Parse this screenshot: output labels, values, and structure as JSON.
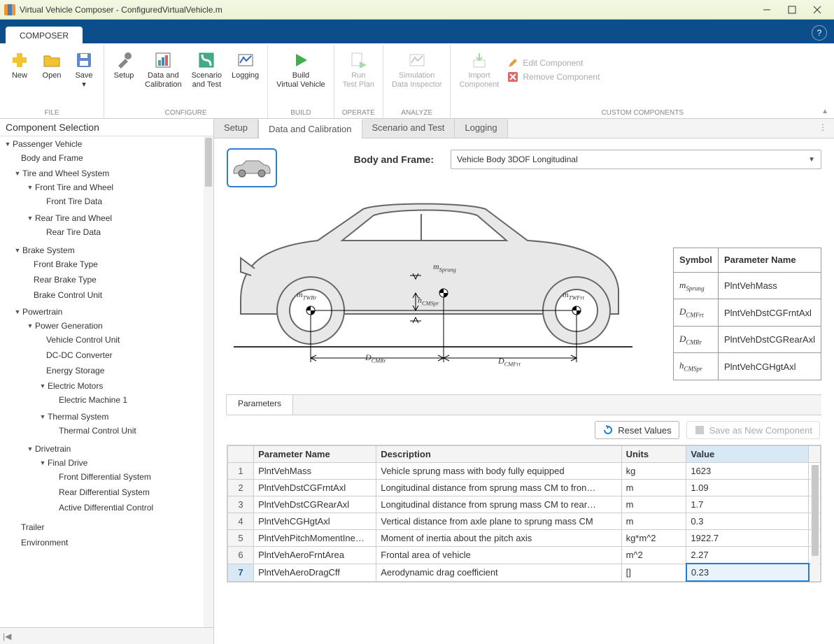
{
  "window": {
    "title": "Virtual Vehicle Composer - ConfiguredVirtualVehicle.m"
  },
  "tabstrip": {
    "main_tab": "COMPOSER"
  },
  "ribbon": {
    "file": {
      "label": "FILE",
      "new": "New",
      "open": "Open",
      "save": "Save"
    },
    "configure": {
      "label": "CONFIGURE",
      "setup": "Setup",
      "data": "Data and\nCalibration",
      "scenario": "Scenario\nand Test",
      "logging": "Logging"
    },
    "build": {
      "label": "BUILD",
      "build": "Build\nVirtual Vehicle"
    },
    "operate": {
      "label": "OPERATE",
      "run": "Run\nTest Plan"
    },
    "analyze": {
      "label": "ANALYZE",
      "sim": "Simulation\nData Inspector"
    },
    "custom": {
      "label": "CUSTOM COMPONENTS",
      "import": "Import\nComponent",
      "edit": "Edit Component",
      "remove": "Remove Component"
    }
  },
  "sidebar": {
    "title": "Component Selection"
  },
  "tree": {
    "pv": "Passenger Vehicle",
    "bf": "Body and Frame",
    "tw": "Tire and Wheel System",
    "ftw": "Front Tire and Wheel",
    "ftd": "Front Tire Data",
    "rtw": "Rear Tire and Wheel",
    "rtd": "Rear Tire Data",
    "bs": "Brake System",
    "fbt": "Front Brake Type",
    "rbt": "Rear Brake Type",
    "bcu": "Brake Control Unit",
    "pt": "Powertrain",
    "pg": "Power Generation",
    "vcu": "Vehicle Control Unit",
    "dcdc": "DC-DC Converter",
    "es": "Energy Storage",
    "em": "Electric Motors",
    "em1": "Electric Machine 1",
    "ts": "Thermal System",
    "tcu": "Thermal Control Unit",
    "dt": "Drivetrain",
    "fd": "Final Drive",
    "fds": "Front Differential System",
    "rds": "Rear Differential System",
    "adc": "Active Differential Control",
    "trailer": "Trailer",
    "env": "Environment"
  },
  "subtabs": {
    "setup": "Setup",
    "data": "Data and Calibration",
    "scenario": "Scenario and Test",
    "logging": "Logging"
  },
  "bodyframe": {
    "label": "Body and Frame:",
    "value": "Vehicle Body 3DOF Longitudinal"
  },
  "diagram": {
    "m_sprung": "m",
    "m_sprung_sub": "Sprung",
    "h": "h",
    "h_sub": "CMSpr",
    "m_twrr": "m",
    "m_twrr_sub": "TWRr",
    "m_twfrt": "m",
    "m_twfrt_sub": "TWFrt",
    "d_rr": "D",
    "d_rr_sub": "CMRr",
    "d_frt": "D",
    "d_frt_sub": "CMFrt"
  },
  "legend": {
    "h_symbol": "Symbol",
    "h_param": "Parameter Name",
    "rows": [
      {
        "sym": "m",
        "sub": "Sprung",
        "name": "PlntVehMass"
      },
      {
        "sym": "D",
        "sub": "CMFrt",
        "name": "PlntVehDstCGFrntAxl"
      },
      {
        "sym": "D",
        "sub": "CMRr",
        "name": "PlntVehDstCGRearAxl"
      },
      {
        "sym": "h",
        "sub": "CMSpr",
        "name": "PlntVehCGHgtAxl"
      }
    ]
  },
  "parameters_tab": "Parameters",
  "buttons": {
    "reset": "Reset Values",
    "save_as": "Save as New Component"
  },
  "ptable": {
    "headers": {
      "name": "Parameter Name",
      "desc": "Description",
      "units": "Units",
      "value": "Value"
    },
    "rows": [
      {
        "n": "1",
        "name": "PlntVehMass",
        "desc": "Vehicle sprung mass with body fully equipped",
        "units": "kg",
        "value": "1623"
      },
      {
        "n": "2",
        "name": "PlntVehDstCGFrntAxl",
        "desc": "Longitudinal distance from sprung mass CM to fron…",
        "units": "m",
        "value": "1.09"
      },
      {
        "n": "3",
        "name": "PlntVehDstCGRearAxl",
        "desc": "Longitudinal distance from sprung mass CM to rear…",
        "units": "m",
        "value": "1.7"
      },
      {
        "n": "4",
        "name": "PlntVehCGHgtAxl",
        "desc": "Vertical distance from axle plane to sprung mass CM",
        "units": "m",
        "value": "0.3"
      },
      {
        "n": "5",
        "name": "PlntVehPitchMomentIne…",
        "desc": "Moment of inertia about the pitch axis",
        "units": "kg*m^2",
        "value": "1922.7"
      },
      {
        "n": "6",
        "name": "PlntVehAeroFrntArea",
        "desc": "Frontal area of vehicle",
        "units": "m^2",
        "value": "2.27"
      },
      {
        "n": "7",
        "name": "PlntVehAeroDragCff",
        "desc": "Aerodynamic drag coefficient",
        "units": "[]",
        "value": "0.23"
      }
    ]
  }
}
